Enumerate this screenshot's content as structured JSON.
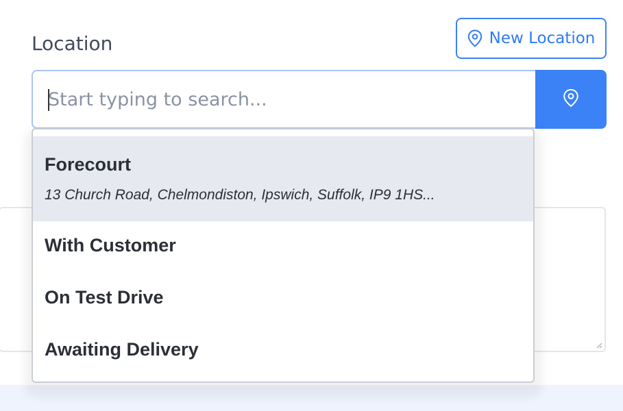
{
  "field": {
    "label": "Location"
  },
  "new_location_button": {
    "label": "New Location",
    "icon": "map-pin-icon"
  },
  "search": {
    "placeholder": "Start typing to search...",
    "value": "",
    "button_icon": "map-pin-icon"
  },
  "dropdown": {
    "items": [
      {
        "title": "Forecourt",
        "address": "13 Church Road, Chelmondiston, Ipswich, Suffolk, IP9 1HS...",
        "highlighted": true
      },
      {
        "title": "With Customer"
      },
      {
        "title": "On Test Drive"
      },
      {
        "title": "Awaiting Delivery"
      }
    ]
  },
  "colors": {
    "accent": "#3b82f6",
    "highlight": "#e7e9f0",
    "label": "#3f4a5a"
  }
}
